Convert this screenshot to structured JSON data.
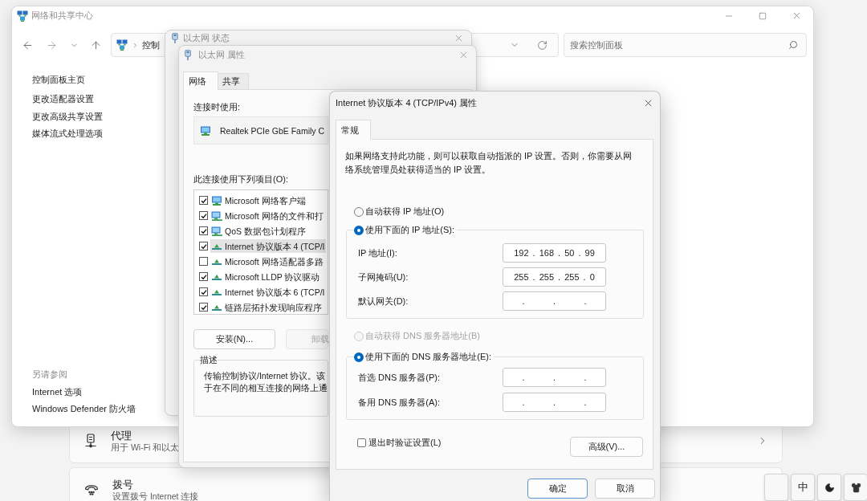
{
  "settings_page": {
    "cards": [
      {
        "kind": "proxy",
        "title": "代理",
        "subtitle": "用于 Wi-Fi 和以太",
        "chevron": true
      },
      {
        "kind": "dialup",
        "title": "拨号",
        "subtitle": "设置拨号 Internet 连接",
        "chevron": false
      }
    ]
  },
  "control_panel": {
    "title": "网络和共享中心",
    "active": false,
    "address": "控制",
    "search": {
      "placeholder": "搜索控制面板"
    },
    "home_link": "控制面板主页",
    "tasks": [
      "更改适配器设置",
      "更改高级共享设置",
      "媒体流式处理选项"
    ],
    "see_also": {
      "heading": "另请参阅",
      "links": [
        "Internet 选项",
        "Windows Defender 防火墙"
      ]
    }
  },
  "status_window": {
    "title": "以太网 状态",
    "active": false
  },
  "properties_window": {
    "title": "以太网 属性",
    "active": false,
    "tabs": [
      {
        "label": "网络",
        "selected": true
      },
      {
        "label": "共享",
        "selected": false
      }
    ],
    "connect_using_label": "连接时使用:",
    "adapter": "Realtek PCIe GbE Family C",
    "items_label": "此连接使用下列项目(O):",
    "items": [
      {
        "label": "Microsoft 网络客户端",
        "kind": "client",
        "checked": true,
        "selected": false
      },
      {
        "label": "Microsoft 网络的文件和打",
        "kind": "service",
        "checked": true,
        "selected": false
      },
      {
        "label": "QoS 数据包计划程序",
        "kind": "service",
        "checked": true,
        "selected": false
      },
      {
        "label": "Internet 协议版本 4 (TCP/I",
        "kind": "protocol",
        "checked": true,
        "selected": true
      },
      {
        "label": "Microsoft 网络适配器多路",
        "kind": "protocol",
        "checked": false,
        "selected": false
      },
      {
        "label": "Microsoft LLDP 协议驱动",
        "kind": "protocol",
        "checked": true,
        "selected": false
      },
      {
        "label": "Internet 协议版本 6 (TCP/I",
        "kind": "protocol",
        "checked": true,
        "selected": false
      },
      {
        "label": "链路层拓扑发现响应程序",
        "kind": "protocol",
        "checked": true,
        "selected": false
      }
    ],
    "buttons": [
      {
        "label": "安装(N)...",
        "disabled": false
      },
      {
        "label": "卸载",
        "disabled": true
      }
    ],
    "description": {
      "heading": "描述",
      "lines": [
        "传输控制协议/Internet 协议。该",
        "于在不同的相互连接的网络上通"
      ]
    }
  },
  "ipv4_dialog": {
    "title": "Internet 协议版本 4 (TCP/IPv4) 属性",
    "active": true,
    "tabs": [
      {
        "label": "常规",
        "selected": true
      }
    ],
    "intro": "如果网络支持此功能，则可以获取自动指派的 IP 设置。否则，你需要从网络系统管理员处获得适当的 IP 设置。",
    "ip_options": [
      {
        "label": "自动获得 IP 地址(O)",
        "selected": false
      },
      {
        "label": "使用下面的 IP 地址(S):",
        "selected": true
      }
    ],
    "ip_fields": [
      {
        "label": "IP 地址(I):",
        "value": "192 . 168 . 50 . 99"
      },
      {
        "label": "子网掩码(U):",
        "value": "255 . 255 . 255 . 0"
      },
      {
        "label": "默认网关(D):",
        "value": ".       .       ."
      }
    ],
    "dns_options": [
      {
        "label": "自动获得 DNS 服务器地址(B)",
        "selected": false,
        "disabled": true
      },
      {
        "label": "使用下面的 DNS 服务器地址(E):",
        "selected": true,
        "disabled": false
      }
    ],
    "dns_fields": [
      {
        "label": "首选 DNS 服务器(P):",
        "value": ".       .       ."
      },
      {
        "label": "备用 DNS 服务器(A):",
        "value": ".       .       ."
      }
    ],
    "validate": {
      "label": "退出时验证设置(L)",
      "checked": false
    },
    "advanced_button": "高级(V)...",
    "buttons": [
      {
        "label": "确定",
        "default": true
      },
      {
        "label": "取消",
        "default": false
      }
    ]
  },
  "ime_toolbar": {
    "mode": "中"
  }
}
